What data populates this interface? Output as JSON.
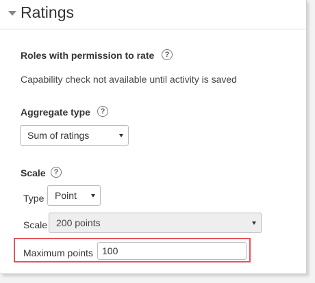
{
  "section": {
    "title": "Ratings",
    "caret_icon": "caret-down-icon"
  },
  "roles": {
    "label": "Roles with permission to rate",
    "help_icon": "?",
    "info": "Capability check not available until activity is saved"
  },
  "aggregate": {
    "label": "Aggregate type",
    "help_icon": "?",
    "selected": "Sum of ratings"
  },
  "scale": {
    "label": "Scale",
    "help_icon": "?",
    "type_label": "Type",
    "type_selected": "Point",
    "scale_label": "Scale",
    "scale_selected": "200 points",
    "max_points_label": "Maximum points",
    "max_points_value": "100"
  },
  "colors": {
    "highlight": "#e5535a"
  }
}
